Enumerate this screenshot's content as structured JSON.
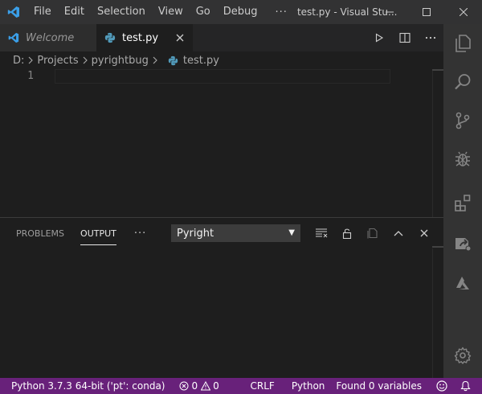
{
  "titlebar": {
    "app_icon": "vscode-logo-icon",
    "menu": [
      "File",
      "Edit",
      "Selection",
      "View",
      "Go",
      "Debug"
    ],
    "more": "···",
    "title": "test.py - Visual Stu..."
  },
  "tabs": [
    {
      "label": "Welcome",
      "icon": "vscode-logo-icon"
    },
    {
      "label": "test.py",
      "icon": "python-icon"
    }
  ],
  "breadcrumb": [
    "D:",
    "Projects",
    "pyrightbug",
    "test.py"
  ],
  "editor": {
    "line_numbers": [
      "1"
    ]
  },
  "panel": {
    "tabs": [
      "PROBLEMS",
      "OUTPUT"
    ],
    "active_tab": "OUTPUT",
    "more": "···",
    "output_channel": "Pyright",
    "caret": "▼"
  },
  "activity_bar": [
    "explorer-icon",
    "search-icon",
    "source-control-icon",
    "debug-icon",
    "extensions-icon",
    "remote-explorer-icon",
    "azure-icon",
    "settings-gear-icon"
  ],
  "statusbar": {
    "interpreter": "Python 3.7.3 64-bit ('pt': conda)",
    "errors": "0",
    "warnings": "0",
    "line_ending": "CRLF",
    "language": "Python",
    "variables": "Found 0 variables"
  },
  "colors": {
    "statusbar": "#68217a",
    "titlebar": "#323233",
    "activity_bar": "#333333",
    "editor_bg": "#1e1e1e",
    "vscode_blue": "#3b9fe8",
    "python_blue": "#519aba"
  }
}
